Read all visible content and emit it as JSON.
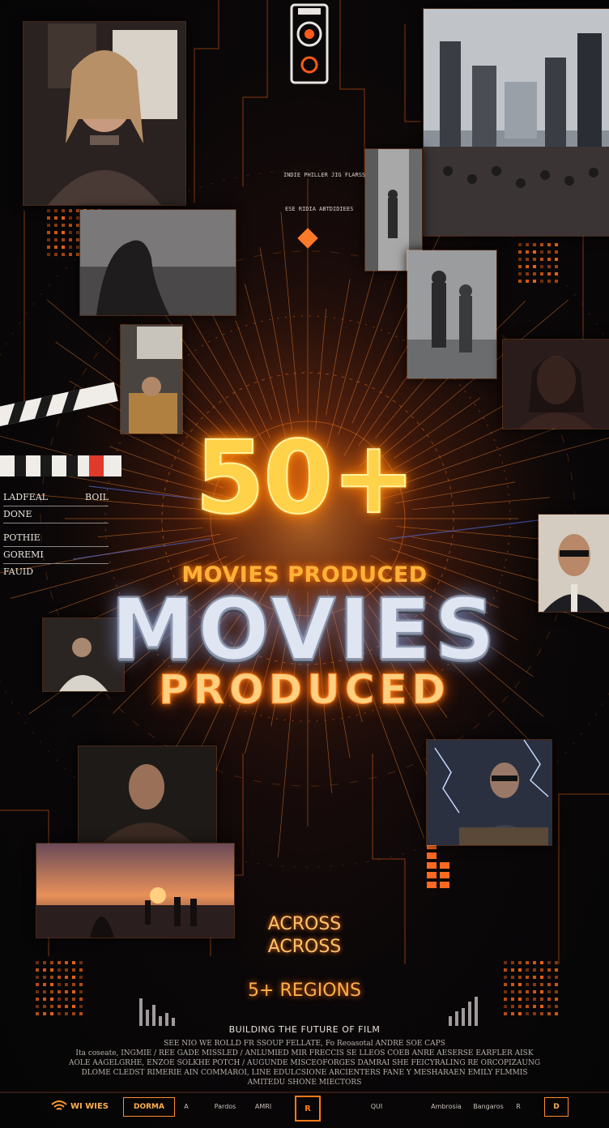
{
  "headline": {
    "number": "50+",
    "subline": "MOVIES PRODUCED",
    "big_word": "MOVIES",
    "produced": "PRODUCED"
  },
  "across": [
    "ACROSS",
    "ACROSS"
  ],
  "regions": "5+ REGIONS",
  "tagline": "BUILDING THE FUTURE OF FILM",
  "credits": [
    "SEE NIO WE ROLLD FR SSOUP FELLATE,   Fo Reoasotal ANDRE SOE CAPS",
    "Ita coseate, INGMIE / REE GADE MISSLED / ANLUMIED MIR FRECCIS SE LLEOS COEB ANRE AESERSE EARFLER AISK",
    "AOLE AAGELGRHE, ENZOE SOLKHE POTCH / AUGUNDE MISCEOFORGES DAMRAI SHE FEICYRALING RE ORCOPIZAUNG",
    "DLOME CLEDST RIMERIE AIN COMMAROI, LINE EDULCSIONE ARCIENTERS FANE Y MESHARAEN EMILY FLMMIS",
    "AMITEDU SHONE MIECTORS"
  ],
  "clapboard_notes": [
    "LADFEAL",
    "DONE",
    "POTHIE",
    "GOREMI",
    "FAUID"
  ],
  "clapboard_side": "BOIL",
  "hud_text": [
    "INDIE PHILLER JIG FLARSS",
    "ESE RIDIA ABTDIDIEES"
  ],
  "logos": [
    "WI WIES",
    "DORMA",
    "A",
    "Pardos",
    "AMRI",
    "R",
    "QUI",
    "Ambrosia",
    "Bangaros",
    "R",
    "D"
  ],
  "colors": {
    "accent_orange": "#ff7a18",
    "glow_yellow": "#ffd24a",
    "chrome": "#dfe6f2",
    "background": "#07070a"
  },
  "icons": [
    "wifi-icon",
    "camera-lens-icon",
    "film-reel-icon",
    "diamond-marker-icon"
  ]
}
